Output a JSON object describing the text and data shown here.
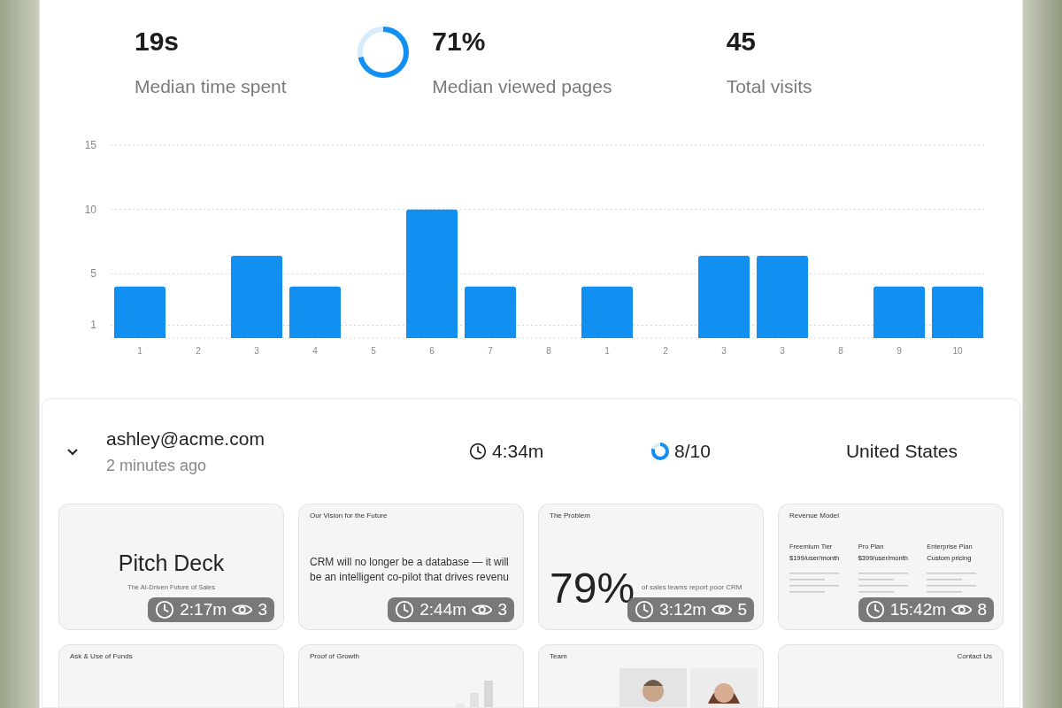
{
  "stats": [
    {
      "kind": "plain",
      "value": "19s",
      "label": "Median time spent"
    },
    {
      "kind": "ring",
      "level": 0.71,
      "value": "71%",
      "label": "Median viewed pages"
    },
    {
      "kind": "plain",
      "value": "45",
      "label": "Total visits"
    }
  ],
  "chart": {
    "chart_data": {
      "type": "bar",
      "categories": [
        "1",
        "2",
        "3",
        "4",
        "5",
        "6",
        "7",
        "8",
        "1",
        "2",
        "3",
        "3",
        "8",
        "9",
        "10"
      ],
      "series": [
        {
          "color": "#1190f2",
          "values": [
            4,
            null,
            6.4,
            4,
            null,
            10,
            4,
            null,
            4,
            null,
            6.4,
            6.4,
            null,
            4,
            4
          ]
        }
      ],
      "grid": true,
      "ylim": [
        0,
        15
      ],
      "yticks": [
        1,
        5,
        10,
        15
      ]
    }
  },
  "session": {
    "expanded": true,
    "email": "ashley@acme.com",
    "when": "2 minutes ago",
    "duration": "4:34m",
    "pages": {
      "level": 0.8,
      "text": "8/10"
    },
    "country": "United States",
    "slides": [
      {
        "kind": "title",
        "title": "Pitch Deck",
        "subtitle": "The AI-Driven Future of Sales",
        "time": "2:17m",
        "views": "3"
      },
      {
        "kind": "statement",
        "heading": "Our Vision for the Future",
        "body": "CRM will no longer be a database — it will be an intelligent co-pilot that drives revenu",
        "time": "2:44m",
        "views": "3"
      },
      {
        "kind": "stat",
        "heading": "The Problem",
        "figure": "79%",
        "caption": "of sales teams report poor CRM",
        "time": "3:12m",
        "views": "5"
      },
      {
        "kind": "pricing",
        "heading": "Revenue Model",
        "plans": [
          {
            "name": "Freemium Tier",
            "price": "$199/user/month"
          },
          {
            "name": "Pro Plan",
            "price": "$399/user/month"
          },
          {
            "name": "Enterprise Plan",
            "price": "Custom pricing"
          }
        ],
        "time": "15:42m",
        "views": "8"
      },
      {
        "kind": "heading",
        "heading": "Ask & Use of Funds"
      },
      {
        "kind": "growth",
        "heading": "Proof of Growth"
      },
      {
        "kind": "team",
        "heading": "Team"
      },
      {
        "kind": "contact",
        "heading": "Contact Us"
      }
    ]
  }
}
